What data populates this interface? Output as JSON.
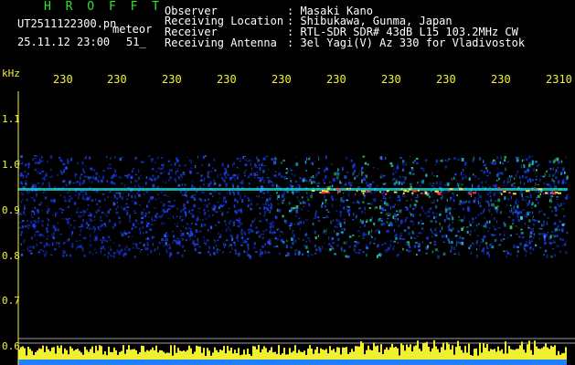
{
  "header": {
    "app_title": "H R O F F T",
    "file_name": "UT2511122300.pn",
    "meteor_label": "meteor",
    "date_time": "25.11.12 23:00",
    "count": "51_"
  },
  "info": [
    {
      "label": "Observer",
      "value": ": Masaki Kano"
    },
    {
      "label": "Receiving Location",
      "value": ": Shibukawa, Gunma, Japan"
    },
    {
      "label": "Receiver",
      "value": ": RTL-SDR SDR# 43dB L15 103.2MHz CW"
    },
    {
      "label": "Receiving Antenna",
      "value": ": 3el Yagi(V) Az 330 for Vladivostok"
    }
  ],
  "axis": {
    "unit": "kHz",
    "time_ticks": [
      "230",
      "230",
      "230",
      "230(",
      "230",
      "230(",
      "230",
      "230(",
      "230",
      "2310"
    ],
    "freq_ticks": [
      "1.1",
      "1.0",
      "0.9",
      "0.8",
      "0.7",
      "0.6"
    ]
  },
  "colors": {
    "background": "#000000",
    "label_green": "#2ee52e",
    "axis_yellow": "#f2f23a",
    "signal_red": "#ff3030",
    "noise_blue": "#1840ff",
    "noise_cyan": "#20d0ff"
  }
}
